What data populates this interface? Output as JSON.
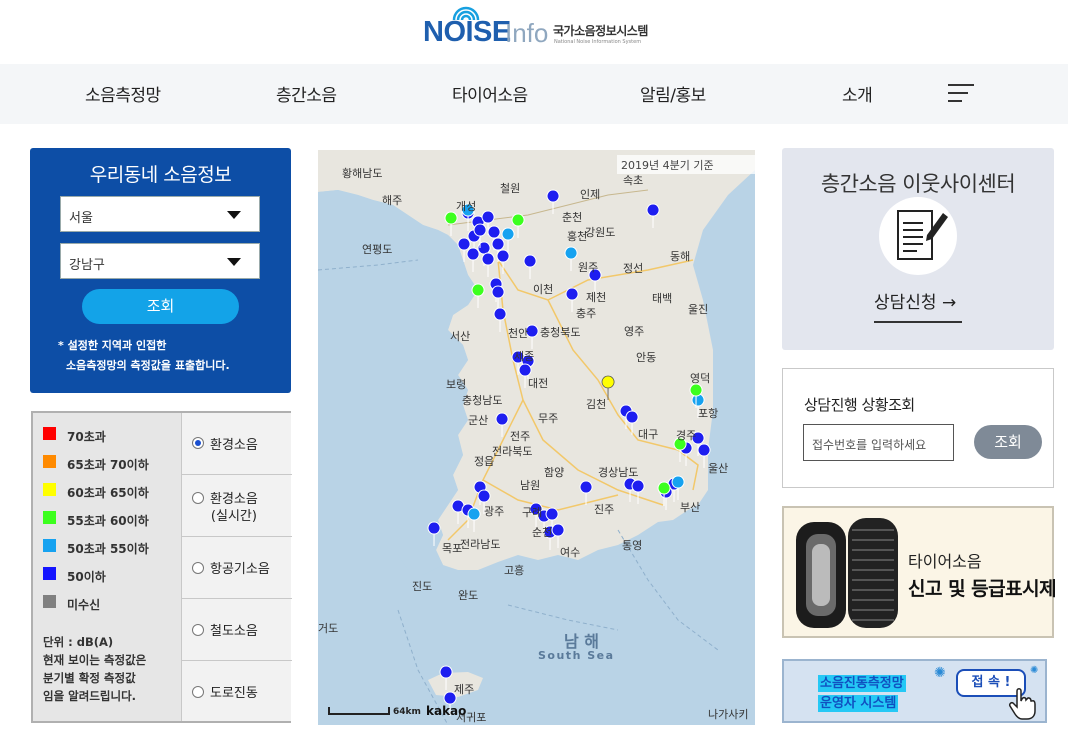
{
  "header": {
    "logo_noise": "NOISE",
    "logo_info": "Info",
    "logo_korean": "국가소음정보시스템",
    "logo_english": "National Noise Information System"
  },
  "nav": {
    "items": [
      "소음측정망",
      "층간소음",
      "타이어소음",
      "알림/홍보",
      "소개"
    ],
    "menu_icon": "hamburger-menu-icon"
  },
  "local_info": {
    "title": "우리동네 소음정보",
    "city_value": "서울",
    "district_value": "강남구",
    "lookup_button": "조회",
    "note_line1": "* 설정한 지역과 인접한",
    "note_line2": "소음측정망의 측정값을 표출합니다."
  },
  "legend": {
    "items": [
      {
        "label": "70초과",
        "color": "#ff0000"
      },
      {
        "label": "65초과 70이하",
        "color": "#ff8a00"
      },
      {
        "label": "60초과 65이하",
        "color": "#ffff00"
      },
      {
        "label": "55초과 60이하",
        "color": "#3cff1e"
      },
      {
        "label": "50초과 55이하",
        "color": "#16a2f0"
      },
      {
        "label": "50이하",
        "color": "#1414ff"
      },
      {
        "label": "미수신",
        "color": "#808080"
      }
    ],
    "unit_line1": "단위 : dB(A)",
    "unit_line2": "현재 보이는 측정값은",
    "unit_line3": "분기별 확정 측정값",
    "unit_line4": "임을 알려드립니다."
  },
  "noise_types": {
    "options": [
      {
        "label": "환경소음",
        "selected": true
      },
      {
        "label": "환경소음\n(실시간)",
        "selected": false
      },
      {
        "label": "항공기소음",
        "selected": false
      },
      {
        "label": "철도소음",
        "selected": false
      },
      {
        "label": "도로진동",
        "selected": false
      }
    ]
  },
  "map": {
    "quarter_label": "2019년 4분기 기준",
    "scale_label": "64km",
    "attribution": "kakao",
    "place_labels": [
      "황해남도",
      "해주",
      "철원",
      "인제",
      "속초",
      "개성",
      "춘천",
      "홍천",
      "강원도",
      "연평도",
      "원주",
      "정선",
      "동해",
      "이천",
      "제천",
      "태백",
      "울진",
      "충주",
      "서산",
      "천안",
      "충청북도",
      "영주",
      "세종",
      "안동",
      "보령",
      "대전",
      "충청남도",
      "영덕",
      "김천",
      "포항",
      "군산",
      "무주",
      "대구",
      "경주",
      "전주",
      "전라북도",
      "정읍",
      "함양",
      "경상남도",
      "울산",
      "남원",
      "광주",
      "진주",
      "부산",
      "구례",
      "전라남도",
      "목포",
      "통영",
      "순천",
      "여수",
      "진도",
      "고흥",
      "완도",
      "남 해",
      "South Sea",
      "제주",
      "서귀포",
      "나가사키",
      "거도"
    ]
  },
  "counseling_center": {
    "title": "층간소음 이웃사이센터",
    "link": "상담신청 →",
    "icon": "document-pen-icon"
  },
  "status_check": {
    "title": "상담진행 상황조회",
    "placeholder": "접수번호를 입력하세요",
    "button": "조회"
  },
  "tire_banner": {
    "line1": "타이어소음",
    "line2": "신고 및 등급표시제"
  },
  "operator_banner": {
    "line1": "소음진동측정망",
    "line2": "운영자 시스템",
    "button": "접 속 !",
    "icon": "hand-pointer-icon"
  }
}
